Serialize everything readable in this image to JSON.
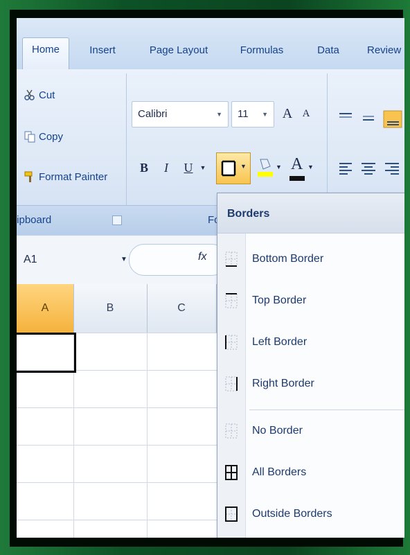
{
  "ribbon": {
    "tabs": [
      {
        "label": "Home",
        "active": true
      },
      {
        "label": "Insert"
      },
      {
        "label": "Page Layout"
      },
      {
        "label": "Formulas"
      },
      {
        "label": "Data"
      },
      {
        "label": "Review"
      }
    ],
    "clipboard": {
      "cut": "Cut",
      "copy": "Copy",
      "format_painter": "Format Painter",
      "group_label": "Clipboard"
    },
    "font": {
      "name": "Calibri",
      "size": "11",
      "grow": "A",
      "shrink": "A",
      "bold": "B",
      "italic": "I",
      "underline": "U",
      "font_color_glyph": "A",
      "group_label": "Font"
    }
  },
  "formula_bar": {
    "name_box": "A1",
    "fx": "fx"
  },
  "columns": [
    "A",
    "B",
    "C"
  ],
  "borders_menu": {
    "title": "Borders",
    "items": [
      {
        "label": "Bottom Border",
        "icon": "bottom-border-icon"
      },
      {
        "label": "Top Border",
        "icon": "top-border-icon"
      },
      {
        "label": "Left Border",
        "icon": "left-border-icon"
      },
      {
        "label": "Right Border",
        "icon": "right-border-icon"
      },
      {
        "label": "No Border",
        "icon": "no-border-icon"
      },
      {
        "label": "All Borders",
        "icon": "all-borders-icon"
      },
      {
        "label": "Outside Borders",
        "icon": "outside-borders-icon"
      }
    ]
  },
  "colors": {
    "ribbon_text": "#15428b",
    "selected_header": "#f5b23d",
    "frame_green": "#1f7a3a"
  }
}
